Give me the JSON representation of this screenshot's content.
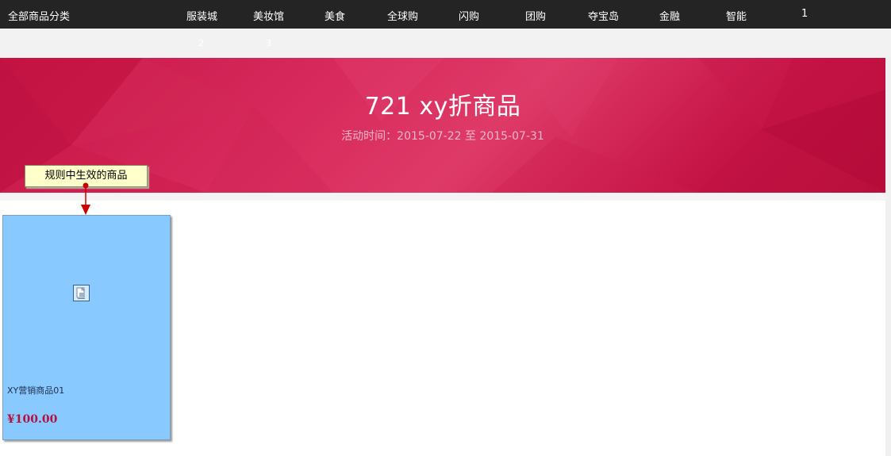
{
  "topnav": {
    "all_categories": "全部商品分类",
    "items": [
      "服装城",
      "美妆馆",
      "美食",
      "全球购",
      "闪购",
      "团购",
      "夺宝岛",
      "金融",
      "智能",
      "1"
    ]
  },
  "subnav": {
    "numbers": [
      "2",
      "3"
    ]
  },
  "banner": {
    "title": "721 xy折商品",
    "time": "活动时间：2015-07-22 至 2015-07-31"
  },
  "callout": {
    "text": "规则中生效的商品"
  },
  "product": {
    "image_icon": "broken-image-icon",
    "name": "XY营销商品01",
    "price": "¥100.00"
  },
  "colors": {
    "topnav_bg": "#242424",
    "banner_red": "#d82a5c",
    "card_bg": "#88c9ff",
    "price": "#b3123f",
    "callout_bg": "#ffffcc",
    "arrow": "#cc0000"
  }
}
